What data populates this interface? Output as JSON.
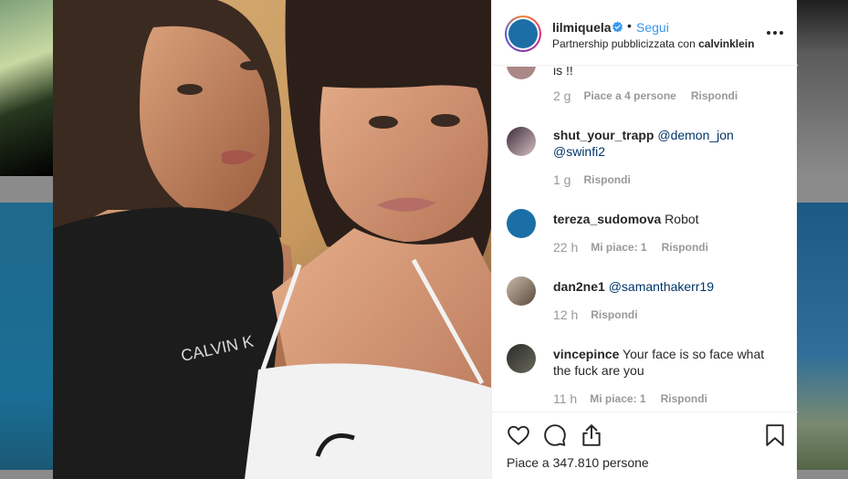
{
  "post": {
    "username": "lilmiquela",
    "follow_label": "Segui",
    "separator": "•",
    "partnership_prefix": "Partnership pubblicizzata con",
    "partner": "calvinklein",
    "likes_text": "Piace a 347.810 persone"
  },
  "photo": {
    "shirt_text": "CALVIN K"
  },
  "comments": [
    {
      "username": "",
      "text": "is !!",
      "mention": "",
      "time": "2 g",
      "likes": "Piace a 4 persone",
      "reply": "Rispondi"
    },
    {
      "username": "shut_your_trapp",
      "text": "",
      "mention": "@demon_jon @swinfi2",
      "time": "1 g",
      "likes": "",
      "reply": "Rispondi"
    },
    {
      "username": "tereza_sudomova",
      "text": "Robot",
      "mention": "",
      "time": "22 h",
      "likes": "Mi piace: 1",
      "reply": "Rispondi"
    },
    {
      "username": "dan2ne1",
      "text": "",
      "mention": "@samanthakerr19",
      "time": "12 h",
      "likes": "",
      "reply": "Rispondi"
    },
    {
      "username": "vincepince",
      "text": "Your face is so face what the fuck are you",
      "mention": "",
      "time": "11 h",
      "likes": "Mi piace: 1",
      "reply": "Rispondi"
    }
  ],
  "icons": {
    "like": "heart-icon",
    "comment": "comment-icon",
    "share": "share-icon",
    "save": "bookmark-icon",
    "more": "more-options-icon",
    "verified": "verified-badge-icon"
  },
  "colors": {
    "link": "#3897f0",
    "mention": "#003569",
    "verified": "#3897f0",
    "avatar_blue": "#1b6fa6"
  }
}
